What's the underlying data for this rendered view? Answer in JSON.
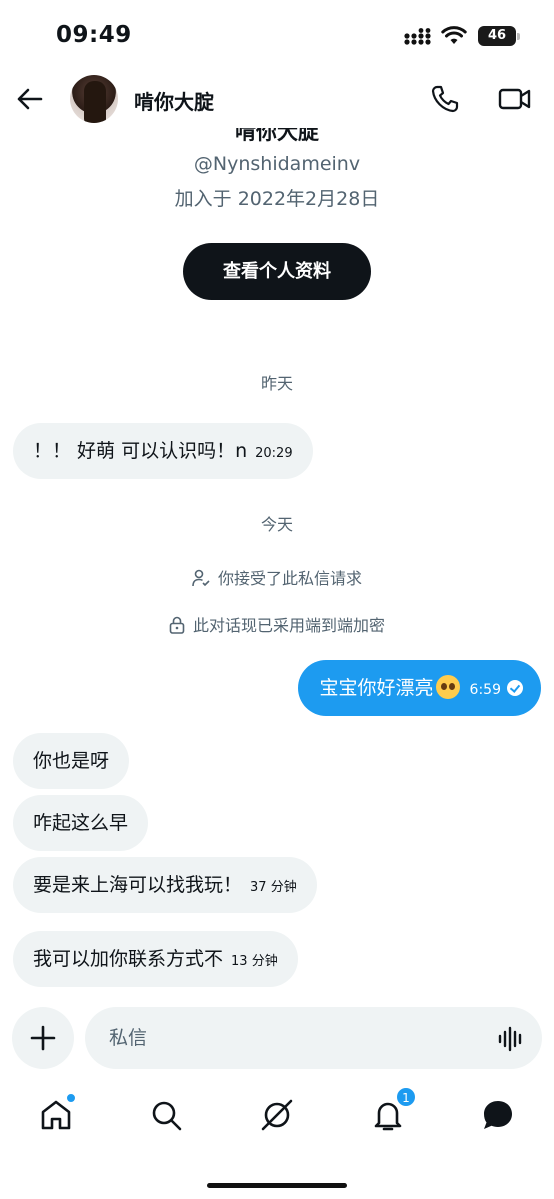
{
  "status_bar": {
    "time": "09:49",
    "battery": "46"
  },
  "header": {
    "name": "啃你大腚",
    "back_icon": "arrow-left-icon",
    "call_icon": "phone-icon",
    "video_icon": "video-camera-icon"
  },
  "profile": {
    "name": "啃你大腚",
    "handle": "@Nynshidameinv",
    "joined": "加入于 2022年2月28日",
    "view_profile_label": "查看个人资料"
  },
  "messages": {
    "yesterday_label": "昨天",
    "today_label": "今天",
    "msg1": {
      "text": "！！ 好萌 可以认识吗！n",
      "time": "20:29"
    },
    "system_accepted": "你接受了此私信请求",
    "system_encrypted": "此对话现已采用端到端加密",
    "out1": {
      "text": "宝宝你好漂亮",
      "time": "6:59",
      "emoji": "pleading-face"
    },
    "msg2": {
      "text": "你也是呀"
    },
    "msg3": {
      "text": "咋起这么早"
    },
    "msg4": {
      "text": "要是来上海可以找我玩！",
      "time": "37 分钟"
    },
    "msg5": {
      "text": "我可以加你联系方式不",
      "time": "13 分钟"
    }
  },
  "composer": {
    "placeholder": "私信"
  },
  "nav": {
    "notifications_badge": "1"
  },
  "colors": {
    "accent": "#1d9bf0",
    "bubble_in": "#eff3f4",
    "text": "#0f1419",
    "muted": "#536471"
  }
}
